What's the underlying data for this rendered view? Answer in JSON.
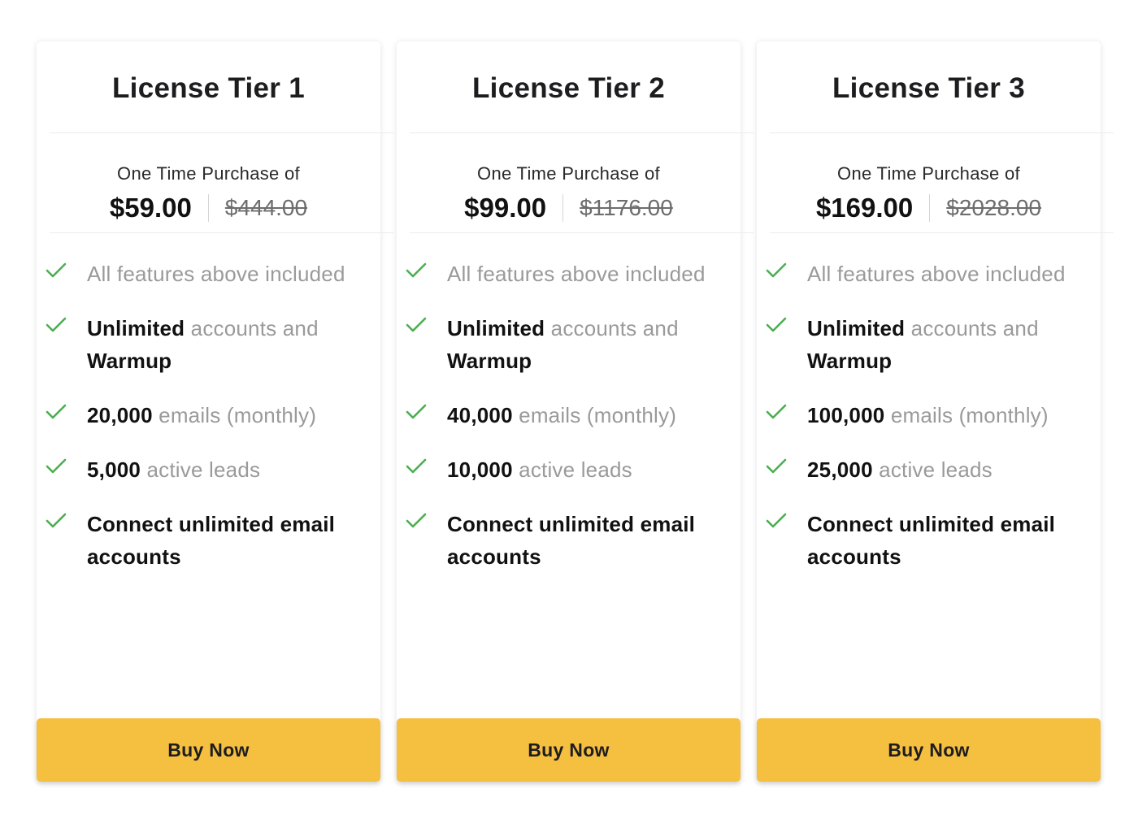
{
  "colors": {
    "accent_button": "#f5bf40",
    "check": "#4caf50",
    "muted_text": "#9a9a9a",
    "strong_text": "#111111"
  },
  "icons": {
    "feature_check": "check-icon"
  },
  "cards": [
    {
      "title": "License Tier 1",
      "purchase_label": "One Time Purchase of",
      "price": "$59.00",
      "old_price": "$444.00",
      "features": [
        {
          "strong": "",
          "text": "All features above included"
        },
        {
          "strong": "Unlimited",
          "text": " accounts and ",
          "strong2": "Warmup"
        },
        {
          "strong": "20,000",
          "text": " emails (monthly)"
        },
        {
          "strong": "5,000",
          "text": " active leads"
        },
        {
          "strong": "Connect unlimited email accounts",
          "text": ""
        }
      ],
      "button_label": "Buy Now"
    },
    {
      "title": "License Tier 2",
      "purchase_label": "One Time Purchase of",
      "price": "$99.00",
      "old_price": "$1176.00",
      "features": [
        {
          "strong": "",
          "text": "All features above included"
        },
        {
          "strong": "Unlimited",
          "text": " accounts and ",
          "strong2": "Warmup"
        },
        {
          "strong": "40,000",
          "text": " emails (monthly)"
        },
        {
          "strong": "10,000",
          "text": " active leads"
        },
        {
          "strong": "Connect unlimited email accounts",
          "text": ""
        }
      ],
      "button_label": "Buy Now"
    },
    {
      "title": "License Tier 3",
      "purchase_label": "One Time Purchase of",
      "price": "$169.00",
      "old_price": "$2028.00",
      "features": [
        {
          "strong": "",
          "text": "All features above included"
        },
        {
          "strong": "Unlimited",
          "text": " accounts and ",
          "strong2": "Warmup"
        },
        {
          "strong": "100,000",
          "text": " emails (monthly)"
        },
        {
          "strong": "25,000",
          "text": " active leads"
        },
        {
          "strong": "Connect unlimited email accounts",
          "text": ""
        }
      ],
      "button_label": "Buy Now"
    }
  ]
}
